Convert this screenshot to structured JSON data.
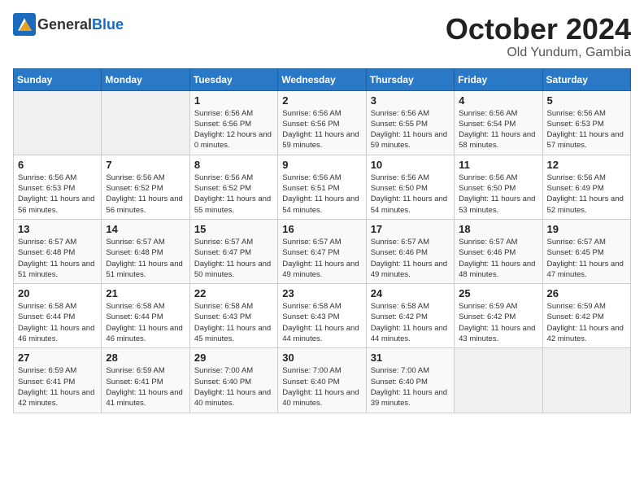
{
  "header": {
    "logo_general": "General",
    "logo_blue": "Blue",
    "month": "October 2024",
    "location": "Old Yundum, Gambia"
  },
  "weekdays": [
    "Sunday",
    "Monday",
    "Tuesday",
    "Wednesday",
    "Thursday",
    "Friday",
    "Saturday"
  ],
  "weeks": [
    [
      {
        "day": "",
        "empty": true
      },
      {
        "day": "",
        "empty": true
      },
      {
        "day": "1",
        "sunrise": "6:56 AM",
        "sunset": "6:56 PM",
        "daylight": "12 hours and 0 minutes."
      },
      {
        "day": "2",
        "sunrise": "6:56 AM",
        "sunset": "6:56 PM",
        "daylight": "11 hours and 59 minutes."
      },
      {
        "day": "3",
        "sunrise": "6:56 AM",
        "sunset": "6:55 PM",
        "daylight": "11 hours and 59 minutes."
      },
      {
        "day": "4",
        "sunrise": "6:56 AM",
        "sunset": "6:54 PM",
        "daylight": "11 hours and 58 minutes."
      },
      {
        "day": "5",
        "sunrise": "6:56 AM",
        "sunset": "6:53 PM",
        "daylight": "11 hours and 57 minutes."
      }
    ],
    [
      {
        "day": "6",
        "sunrise": "6:56 AM",
        "sunset": "6:53 PM",
        "daylight": "11 hours and 56 minutes."
      },
      {
        "day": "7",
        "sunrise": "6:56 AM",
        "sunset": "6:52 PM",
        "daylight": "11 hours and 56 minutes."
      },
      {
        "day": "8",
        "sunrise": "6:56 AM",
        "sunset": "6:52 PM",
        "daylight": "11 hours and 55 minutes."
      },
      {
        "day": "9",
        "sunrise": "6:56 AM",
        "sunset": "6:51 PM",
        "daylight": "11 hours and 54 minutes."
      },
      {
        "day": "10",
        "sunrise": "6:56 AM",
        "sunset": "6:50 PM",
        "daylight": "11 hours and 54 minutes."
      },
      {
        "day": "11",
        "sunrise": "6:56 AM",
        "sunset": "6:50 PM",
        "daylight": "11 hours and 53 minutes."
      },
      {
        "day": "12",
        "sunrise": "6:56 AM",
        "sunset": "6:49 PM",
        "daylight": "11 hours and 52 minutes."
      }
    ],
    [
      {
        "day": "13",
        "sunrise": "6:57 AM",
        "sunset": "6:48 PM",
        "daylight": "11 hours and 51 minutes."
      },
      {
        "day": "14",
        "sunrise": "6:57 AM",
        "sunset": "6:48 PM",
        "daylight": "11 hours and 51 minutes."
      },
      {
        "day": "15",
        "sunrise": "6:57 AM",
        "sunset": "6:47 PM",
        "daylight": "11 hours and 50 minutes."
      },
      {
        "day": "16",
        "sunrise": "6:57 AM",
        "sunset": "6:47 PM",
        "daylight": "11 hours and 49 minutes."
      },
      {
        "day": "17",
        "sunrise": "6:57 AM",
        "sunset": "6:46 PM",
        "daylight": "11 hours and 49 minutes."
      },
      {
        "day": "18",
        "sunrise": "6:57 AM",
        "sunset": "6:46 PM",
        "daylight": "11 hours and 48 minutes."
      },
      {
        "day": "19",
        "sunrise": "6:57 AM",
        "sunset": "6:45 PM",
        "daylight": "11 hours and 47 minutes."
      }
    ],
    [
      {
        "day": "20",
        "sunrise": "6:58 AM",
        "sunset": "6:44 PM",
        "daylight": "11 hours and 46 minutes."
      },
      {
        "day": "21",
        "sunrise": "6:58 AM",
        "sunset": "6:44 PM",
        "daylight": "11 hours and 46 minutes."
      },
      {
        "day": "22",
        "sunrise": "6:58 AM",
        "sunset": "6:43 PM",
        "daylight": "11 hours and 45 minutes."
      },
      {
        "day": "23",
        "sunrise": "6:58 AM",
        "sunset": "6:43 PM",
        "daylight": "11 hours and 44 minutes."
      },
      {
        "day": "24",
        "sunrise": "6:58 AM",
        "sunset": "6:42 PM",
        "daylight": "11 hours and 44 minutes."
      },
      {
        "day": "25",
        "sunrise": "6:59 AM",
        "sunset": "6:42 PM",
        "daylight": "11 hours and 43 minutes."
      },
      {
        "day": "26",
        "sunrise": "6:59 AM",
        "sunset": "6:42 PM",
        "daylight": "11 hours and 42 minutes."
      }
    ],
    [
      {
        "day": "27",
        "sunrise": "6:59 AM",
        "sunset": "6:41 PM",
        "daylight": "11 hours and 42 minutes."
      },
      {
        "day": "28",
        "sunrise": "6:59 AM",
        "sunset": "6:41 PM",
        "daylight": "11 hours and 41 minutes."
      },
      {
        "day": "29",
        "sunrise": "7:00 AM",
        "sunset": "6:40 PM",
        "daylight": "11 hours and 40 minutes."
      },
      {
        "day": "30",
        "sunrise": "7:00 AM",
        "sunset": "6:40 PM",
        "daylight": "11 hours and 40 minutes."
      },
      {
        "day": "31",
        "sunrise": "7:00 AM",
        "sunset": "6:40 PM",
        "daylight": "11 hours and 39 minutes."
      },
      {
        "day": "",
        "empty": true
      },
      {
        "day": "",
        "empty": true
      }
    ]
  ]
}
